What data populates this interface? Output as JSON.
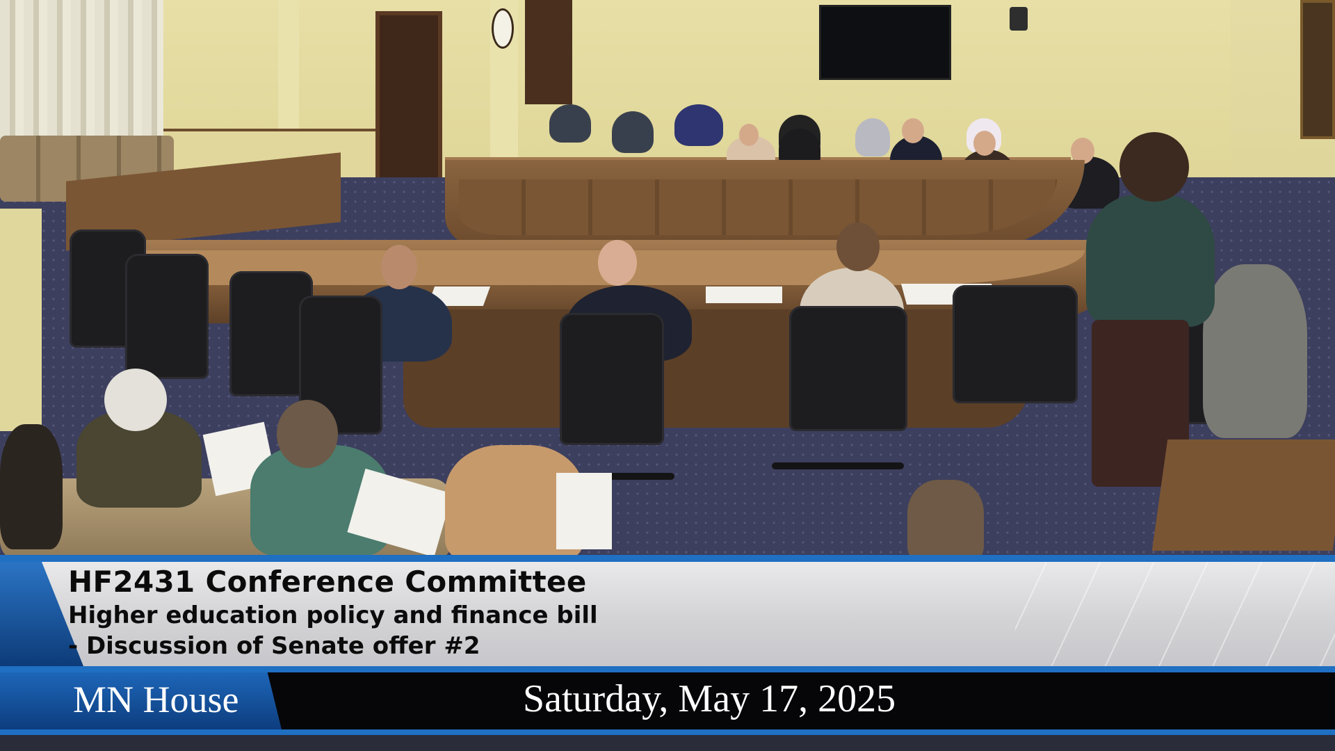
{
  "lower_third": {
    "title": "HF2431 Conference Committee",
    "subtitle_line1": "Higher education policy and finance bill",
    "subtitle_line2": "- Discussion of Senate offer #2"
  },
  "footer": {
    "channel": "MN House",
    "date": "Saturday, May 17, 2025"
  },
  "colors": {
    "accent_blue": "#1f6fc2",
    "footer_bg": "#060608",
    "panel_grey": "#d3d3d6"
  }
}
